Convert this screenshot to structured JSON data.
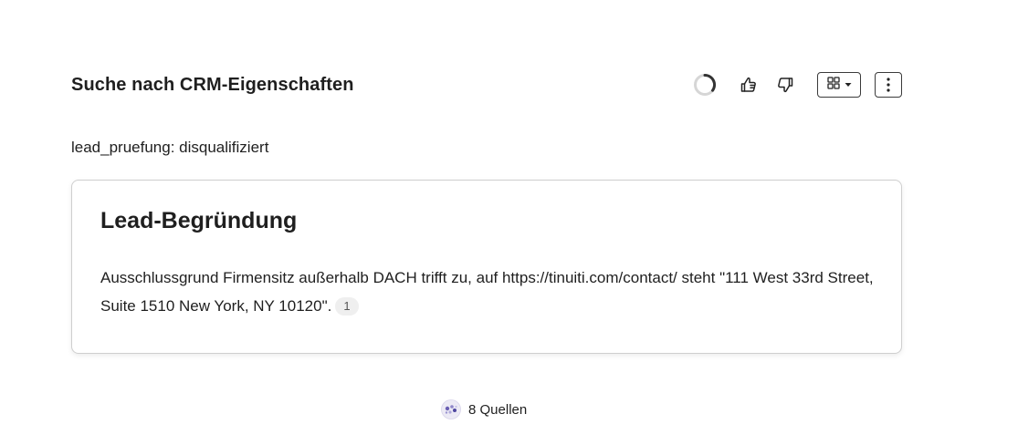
{
  "header": {
    "title": "Suche nach CRM-Eigenschaften",
    "icons": {
      "status": "loading-spinner-icon",
      "like": "thumbs-up-icon",
      "dislike": "thumbs-down-icon",
      "view": "grid-view-icon",
      "more": "more-vertical-icon"
    }
  },
  "property": {
    "line": "lead_pruefung: disqualifiziert"
  },
  "card": {
    "title": "Lead-Begründung",
    "text": "Ausschlussgrund Firmensitz außerhalb DACH trifft zu, auf https://tinuiti.com/contact/ steht \"111 West 33rd Street, Suite 1510 New York, NY 10120\".",
    "citation": "1"
  },
  "sources": {
    "label": "8 Quellen",
    "icon": "sources-avatar-icon"
  },
  "colors": {
    "text": "#1f1f1f",
    "border": "#cfcfcf",
    "citation_bg": "#efefef"
  }
}
